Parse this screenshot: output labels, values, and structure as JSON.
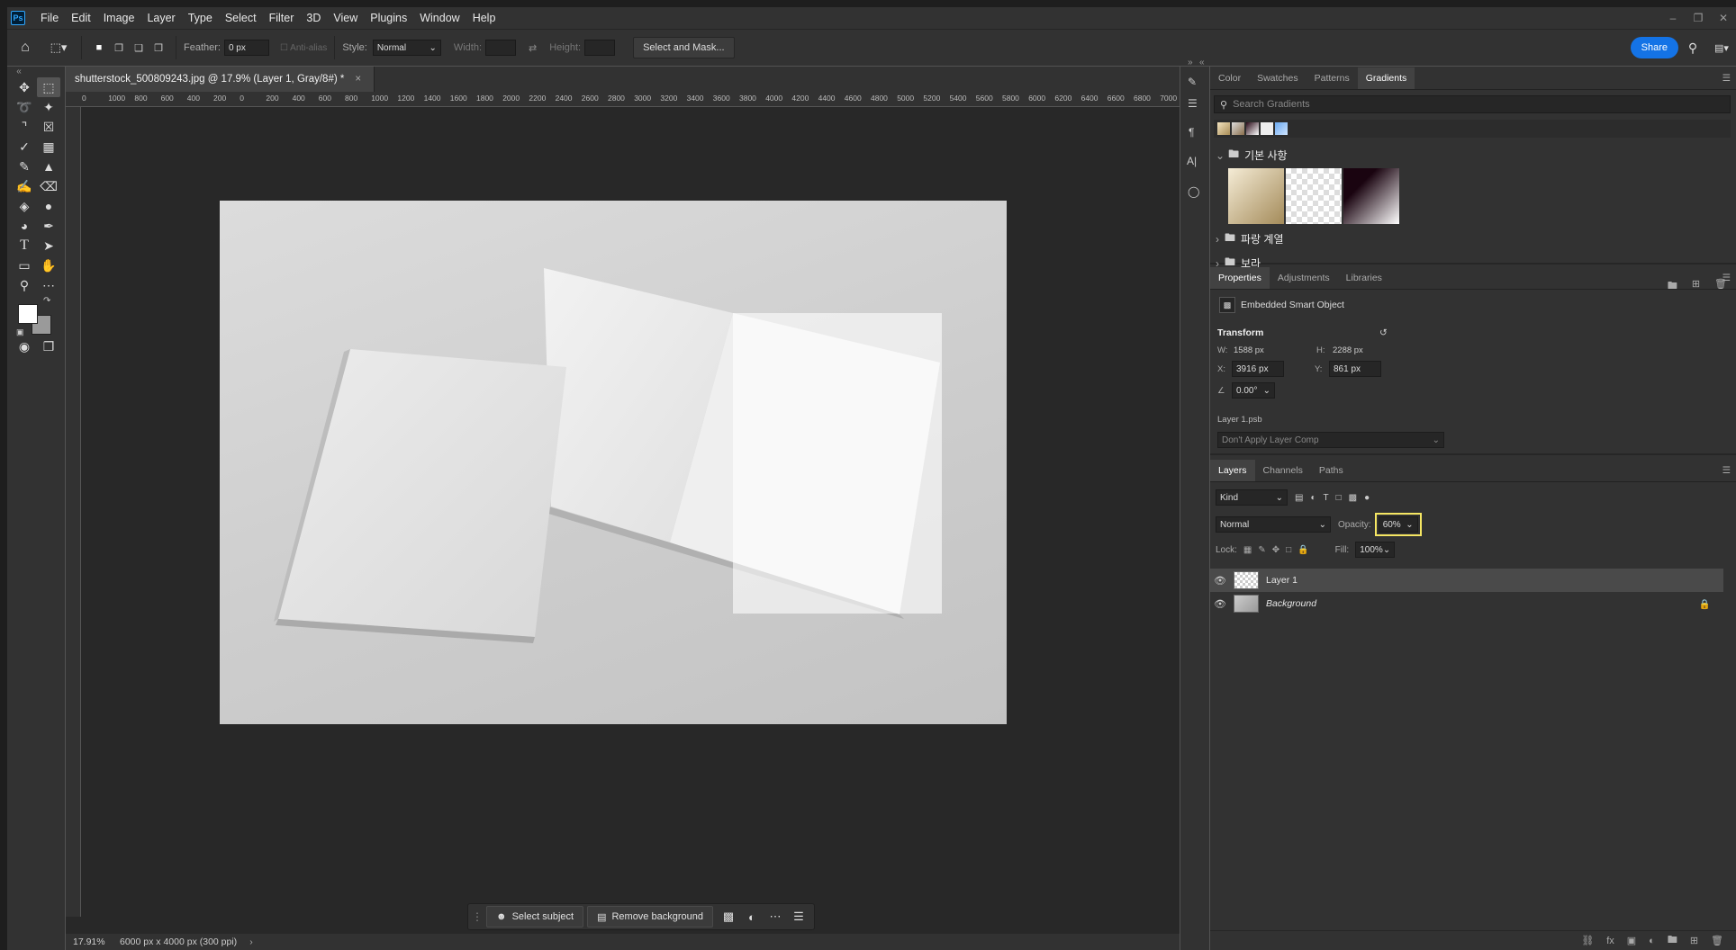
{
  "app": {
    "logo": "Ps"
  },
  "menu": [
    "File",
    "Edit",
    "Image",
    "Layer",
    "Type",
    "Select",
    "Filter",
    "3D",
    "View",
    "Plugins",
    "Window",
    "Help"
  ],
  "options": {
    "feather_label": "Feather:",
    "feather_value": "0 px",
    "antialias_label": "Anti-alias",
    "style_label": "Style:",
    "style_value": "Normal",
    "width_label": "Width:",
    "height_label": "Height:",
    "select_mask": "Select and Mask...",
    "share": "Share"
  },
  "document": {
    "tab_title": "shutterstock_500809243.jpg @ 17.9% (Layer 1, Gray/8#) *",
    "zoom": "17.91%",
    "doc_size": "6000 px x 4000 px (300 ppi)"
  },
  "ruler_ticks": [
    "0",
    "1000",
    "800",
    "600",
    "400",
    "200",
    "0",
    "200",
    "400",
    "600",
    "800",
    "1000",
    "1200",
    "1400",
    "1600",
    "1800",
    "2000",
    "2200",
    "2400",
    "2600",
    "2800",
    "3000",
    "3200",
    "3400",
    "3600",
    "3800",
    "4000",
    "4200",
    "4400",
    "4600",
    "4800",
    "5000",
    "5200",
    "5400",
    "5600",
    "5800",
    "6000",
    "6200",
    "6400",
    "6600",
    "6800",
    "7000"
  ],
  "context_bar": {
    "select_subject": "Select subject",
    "remove_background": "Remove background"
  },
  "gradients_panel": {
    "tabs": [
      "Color",
      "Swatches",
      "Patterns",
      "Gradients"
    ],
    "active_tab": "Gradients",
    "search_placeholder": "Search Gradients",
    "groups": [
      "기본 사항",
      "파랑 계열",
      "보라"
    ]
  },
  "properties_panel": {
    "tabs": [
      "Properties",
      "Adjustments",
      "Libraries"
    ],
    "active_tab": "Properties",
    "object_type": "Embedded Smart Object",
    "transform_label": "Transform",
    "w_label": "W:",
    "w_value": "1588 px",
    "h_label": "H:",
    "h_value": "2288 px",
    "x_label": "X:",
    "x_value": "3916 px",
    "y_label": "Y:",
    "y_value": "861 px",
    "angle_value": "0.00°",
    "linked_file": "Layer 1.psb",
    "layer_comp": "Don't Apply Layer Comp"
  },
  "layers_panel": {
    "tabs": [
      "Layers",
      "Channels",
      "Paths"
    ],
    "active_tab": "Layers",
    "kind_label": "Kind",
    "blend_mode": "Normal",
    "opacity_label": "Opacity:",
    "opacity_value": "60%",
    "lock_label": "Lock:",
    "fill_label": "Fill:",
    "fill_value": "100%",
    "layers": [
      {
        "name": "Layer 1",
        "selected": true
      },
      {
        "name": "Background",
        "locked": true
      }
    ]
  },
  "colors": {
    "highlight": "#f5e663",
    "accent": "#1473e6"
  }
}
